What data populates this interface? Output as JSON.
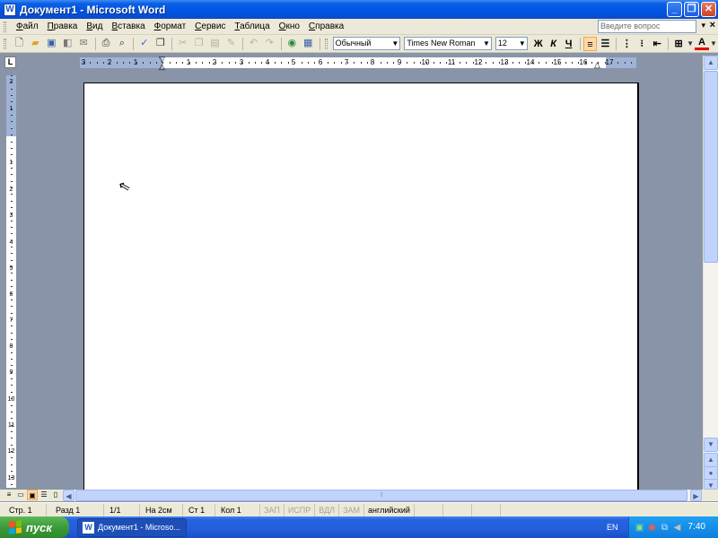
{
  "window": {
    "title": "Документ1 - Microsoft Word",
    "app_icon": "W",
    "buttons": {
      "minimize": "_",
      "restore": "❐",
      "close": "✕"
    }
  },
  "menu": {
    "items": [
      "Файл",
      "Правка",
      "Вид",
      "Вставка",
      "Формат",
      "Сервис",
      "Таблица",
      "Окно",
      "Справка"
    ],
    "ask_placeholder": "Введите вопрос",
    "ask_dropdown": "▾",
    "doc_close": "×"
  },
  "toolbar": {
    "style_value": "Обычный",
    "font_value": "Times New Roman",
    "size_value": "12",
    "bold_label": "Ж",
    "italic_label": "К",
    "underline_label": "Ч",
    "font_color_label": "A"
  },
  "ruler": {
    "corner_label": "L",
    "h_labels": [
      "3",
      "2",
      "1",
      "1",
      "2",
      "3",
      "4",
      "5",
      "6",
      "7",
      "8",
      "9",
      "10",
      "11",
      "12",
      "13",
      "14",
      "15",
      "16",
      "17"
    ],
    "v_labels": [
      "2",
      "1",
      "1",
      "2",
      "3",
      "4",
      "5",
      "6",
      "7",
      "8",
      "9",
      "10",
      "11",
      "12",
      "13"
    ]
  },
  "status": {
    "page": "Стр. 1",
    "section": "Разд 1",
    "page_of": "1/1",
    "at": "На 2см",
    "line": "Ст 1",
    "col": "Кол 1",
    "rec": "ЗАП",
    "trk": "ИСПР",
    "ext": "ВДЛ",
    "ovr": "ЗАМ",
    "language": "английский"
  },
  "taskbar": {
    "start_label": "пуск",
    "task_word": "Документ1 - Microso...",
    "lang": "EN",
    "time": "7:40"
  },
  "colors": {
    "title_bar": "#0054e3",
    "chrome": "#ece9d8",
    "workspace": "#8a94a8",
    "start_green": "#3c9a38",
    "font_color_underline": "#e00000"
  }
}
